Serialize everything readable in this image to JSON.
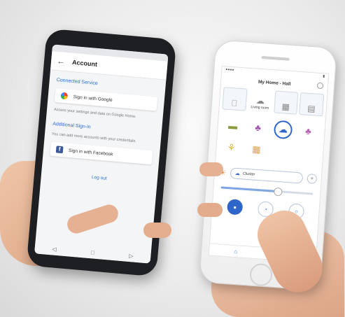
{
  "android_phone": {
    "title": "Account",
    "back_glyph": "←",
    "status_time": "",
    "section_connected": "Connected Service",
    "google_button": "Sign in with Google",
    "google_note": "Access your settings and data on Google Home.",
    "section_additional": "Additional Sign-in",
    "additional_note": "You can add more accounts with your credentials.",
    "facebook_button": "Sign in with Facebook",
    "signout_link": "Log out",
    "nav_icons": [
      "◁",
      "□",
      "▷"
    ]
  },
  "iphone": {
    "status_left": "●●●●",
    "status_right": "▮",
    "header_title": "My Home - Hall",
    "tabs": [
      {
        "label": "",
        "glyph": "⎕",
        "active": false
      },
      {
        "label": "Living room",
        "glyph": "☁",
        "active": true
      },
      {
        "label": "",
        "glyph": "▦",
        "active": false
      },
      {
        "label": "",
        "glyph": "▤",
        "active": false
      }
    ],
    "grid_icons": [
      {
        "glyph": "▬",
        "color": "#8a9a3c",
        "selected": false
      },
      {
        "glyph": "♣",
        "color": "#a05bb0",
        "selected": false
      },
      {
        "glyph": "☁",
        "color": "#2f66c9",
        "selected": true
      },
      {
        "glyph": "♣",
        "color": "#b865b0",
        "selected": false
      },
      {
        "glyph": "⚘",
        "color": "#d7b53a",
        "selected": false
      },
      {
        "glyph": "▦",
        "color": "#e0a43a",
        "selected": false
      }
    ],
    "mode_icon": "☀",
    "mode_pill_icon": "☁",
    "mode_pill_label": "Cluster",
    "plus_glyph": "+",
    "slider_level": 0.62,
    "bottom_buttons": [
      "●",
      "◔",
      "○"
    ],
    "tabbar_icons": [
      "⌂",
      "☰"
    ]
  }
}
